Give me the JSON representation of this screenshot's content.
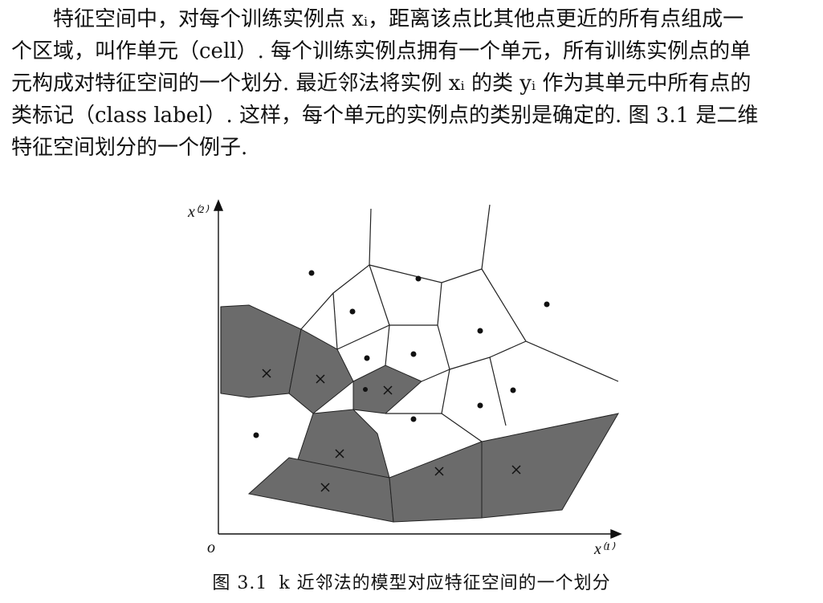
{
  "paragraph": {
    "lines": [
      "特征空间中，对每个训练实例点 xᵢ，距离该点比其他点更近的所有点组成一",
      "个区域，叫作单元（cell）. 每个训练实例点拥有一个单元，所有训练实例点的单",
      "元构成对特征空间的一个划分. 最近邻法将实例 xᵢ 的类 yᵢ 作为其单元中所有点的",
      "类标记（class label）. 这样，每个单元的实例点的类别是确定的. 图 3.1 是二维",
      "特征空间划分的一个例子."
    ]
  },
  "figure": {
    "y_axis_label": "x⁽²⁾",
    "x_axis_label": "x⁽¹⁾",
    "origin_label": "o",
    "caption_number": "图 3.1",
    "caption_text": "k 近邻法的模型对应特征空间的一个划分",
    "colors": {
      "shaded_cell": "#6b6b6b",
      "edge": "#222222",
      "background": "#ffffff"
    },
    "point_markers": {
      "dot_class": "•",
      "cross_class": "×"
    }
  }
}
